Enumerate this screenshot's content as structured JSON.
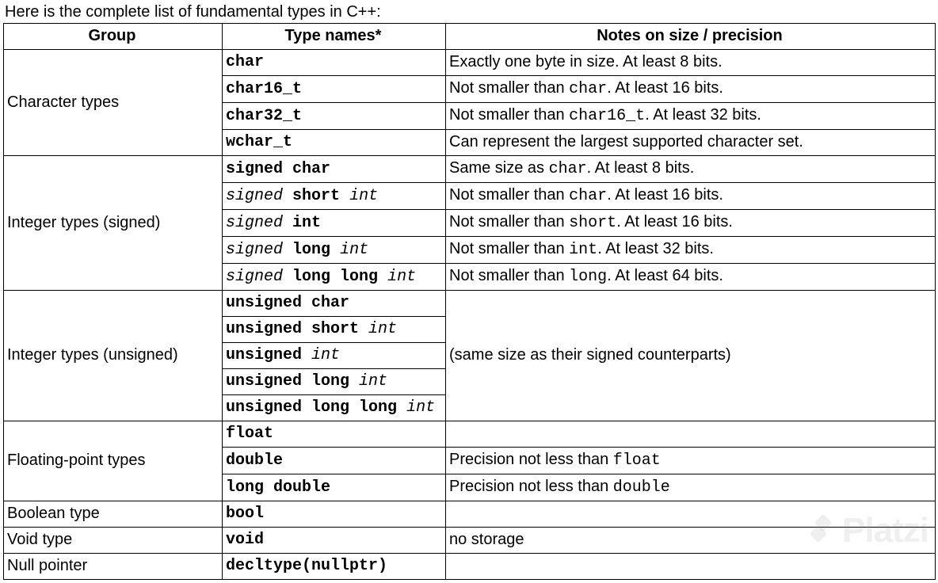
{
  "intro": "Here is the complete list of fundamental types in C++:",
  "headers": {
    "group": "Group",
    "type": "Type names*",
    "notes": "Notes on size / precision"
  },
  "groups": [
    {
      "name": "Character types",
      "rows": [
        {
          "type": [
            [
              "b",
              "char"
            ]
          ],
          "note": [
            [
              "t",
              "Exactly one byte in size. At least 8 bits."
            ]
          ]
        },
        {
          "type": [
            [
              "b",
              "char16_t"
            ]
          ],
          "note": [
            [
              "t",
              "Not smaller than "
            ],
            [
              "m",
              "char"
            ],
            [
              "t",
              ". At least 16 bits."
            ]
          ]
        },
        {
          "type": [
            [
              "b",
              "char32_t"
            ]
          ],
          "note": [
            [
              "t",
              "Not smaller than "
            ],
            [
              "m",
              "char16_t"
            ],
            [
              "t",
              ". At least 32 bits."
            ]
          ]
        },
        {
          "type": [
            [
              "b",
              "wchar_t"
            ]
          ],
          "note": [
            [
              "t",
              "Can represent the largest supported character set."
            ]
          ]
        }
      ]
    },
    {
      "name": "Integer types (signed)",
      "rows": [
        {
          "type": [
            [
              "b",
              "signed char"
            ]
          ],
          "note": [
            [
              "t",
              "Same size as "
            ],
            [
              "m",
              "char"
            ],
            [
              "t",
              ". At least 8 bits."
            ]
          ]
        },
        {
          "type": [
            [
              "i",
              "signed"
            ],
            [
              "t",
              " "
            ],
            [
              "b",
              "short"
            ],
            [
              "t",
              " "
            ],
            [
              "i",
              "int"
            ]
          ],
          "note": [
            [
              "t",
              "Not smaller than "
            ],
            [
              "m",
              "char"
            ],
            [
              "t",
              ". At least 16 bits."
            ]
          ]
        },
        {
          "type": [
            [
              "i",
              "signed"
            ],
            [
              "t",
              " "
            ],
            [
              "b",
              "int"
            ]
          ],
          "note": [
            [
              "t",
              "Not smaller than "
            ],
            [
              "m",
              "short"
            ],
            [
              "t",
              ". At least 16 bits."
            ]
          ]
        },
        {
          "type": [
            [
              "i",
              "signed"
            ],
            [
              "t",
              " "
            ],
            [
              "b",
              "long"
            ],
            [
              "t",
              " "
            ],
            [
              "i",
              "int"
            ]
          ],
          "note": [
            [
              "t",
              "Not smaller than "
            ],
            [
              "m",
              "int"
            ],
            [
              "t",
              ". At least 32 bits."
            ]
          ]
        },
        {
          "type": [
            [
              "i",
              "signed"
            ],
            [
              "t",
              " "
            ],
            [
              "b",
              "long long"
            ],
            [
              "t",
              " "
            ],
            [
              "i",
              "int"
            ]
          ],
          "note": [
            [
              "t",
              "Not smaller than "
            ],
            [
              "m",
              "long"
            ],
            [
              "t",
              ". At least 64 bits."
            ]
          ]
        }
      ]
    },
    {
      "name": "Integer types (unsigned)",
      "sharedNote": [
        [
          "t",
          "(same size as their signed counterparts)"
        ]
      ],
      "rows": [
        {
          "type": [
            [
              "b",
              "unsigned char"
            ]
          ]
        },
        {
          "type": [
            [
              "b",
              "unsigned short"
            ],
            [
              "t",
              " "
            ],
            [
              "i",
              "int"
            ]
          ]
        },
        {
          "type": [
            [
              "b",
              "unsigned"
            ],
            [
              "t",
              " "
            ],
            [
              "i",
              "int"
            ]
          ]
        },
        {
          "type": [
            [
              "b",
              "unsigned long"
            ],
            [
              "t",
              " "
            ],
            [
              "i",
              "int"
            ]
          ]
        },
        {
          "type": [
            [
              "b",
              "unsigned long long"
            ],
            [
              "t",
              " "
            ],
            [
              "i",
              "int"
            ]
          ]
        }
      ]
    },
    {
      "name": "Floating-point types",
      "rows": [
        {
          "type": [
            [
              "b",
              "float"
            ]
          ],
          "note": [
            [
              "t",
              ""
            ]
          ]
        },
        {
          "type": [
            [
              "b",
              "double"
            ]
          ],
          "note": [
            [
              "t",
              "Precision not less than "
            ],
            [
              "m",
              "float"
            ]
          ]
        },
        {
          "type": [
            [
              "b",
              "long double"
            ]
          ],
          "note": [
            [
              "t",
              "Precision not less than "
            ],
            [
              "m",
              "double"
            ]
          ]
        }
      ]
    },
    {
      "name": "Boolean type",
      "rows": [
        {
          "type": [
            [
              "b",
              "bool"
            ]
          ],
          "note": [
            [
              "t",
              ""
            ]
          ]
        }
      ]
    },
    {
      "name": "Void type",
      "rows": [
        {
          "type": [
            [
              "b",
              "void"
            ]
          ],
          "note": [
            [
              "t",
              "no storage"
            ]
          ]
        }
      ]
    },
    {
      "name": "Null pointer",
      "rows": [
        {
          "type": [
            [
              "b",
              "decltype(nullptr)"
            ]
          ],
          "note": [
            [
              "t",
              ""
            ]
          ]
        }
      ]
    }
  ],
  "watermark": "Platzi"
}
